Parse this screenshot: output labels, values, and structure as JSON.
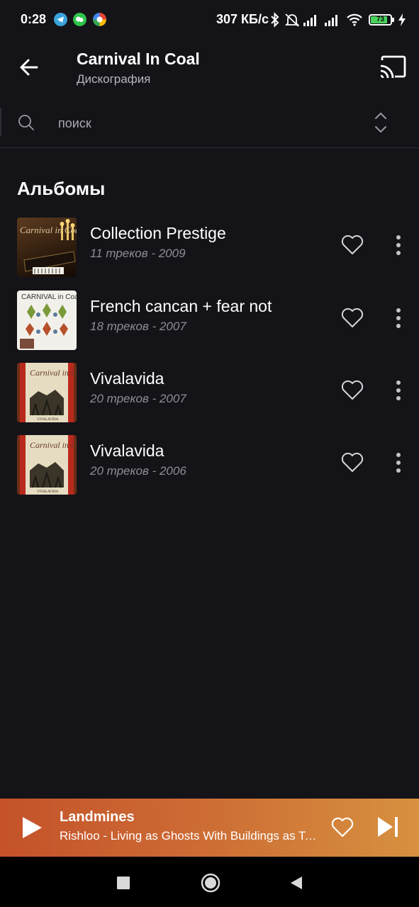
{
  "status_bar": {
    "time": "0:28",
    "speed": "307 КБ/с",
    "battery": "73",
    "icons": [
      "telegram-icon",
      "wechat-icon",
      "app-icon",
      "bluetooth-icon",
      "alarm-off-icon",
      "signal-icon",
      "signal-icon",
      "wifi-icon",
      "battery-icon",
      "charging-icon"
    ]
  },
  "app_bar": {
    "title": "Carnival In Coal",
    "subtitle": "Дискография",
    "icons": [
      "back-arrow-icon",
      "cast-icon"
    ]
  },
  "search": {
    "placeholder": "поиск",
    "icons": [
      "search-icon",
      "sort-icon"
    ]
  },
  "section": {
    "title": "Альбомы"
  },
  "albums": [
    {
      "title": "Collection Prestige",
      "meta": "11 треков - 2009"
    },
    {
      "title": "French cancan + fear not",
      "meta": "18 треков - 2007"
    },
    {
      "title": "Vivalavida",
      "meta": "20 треков - 2007"
    },
    {
      "title": "Vivalavida",
      "meta": "20 треков - 2006"
    }
  ],
  "cover_text": {
    "cover1": "Carnival in Coal",
    "cover2": "CARNIVAL in Coal",
    "cover3": "Carnival in Coal",
    "cover3_bottom": "VIVALAVIDA",
    "cover4": "Carnival in Coal",
    "cover4_bottom": "VIVALAVIDA"
  },
  "mini_player": {
    "title": "Landmines",
    "subtitle": "Rishloo - Living as Ghosts With Buildings as Teeth",
    "icons": [
      "play-icon",
      "heart-icon",
      "skip-next-icon"
    ]
  },
  "colors": {
    "background": "#141318",
    "player_start": "#c4522a",
    "player_end": "#d7913f",
    "muted_text": "#8e8d94"
  }
}
